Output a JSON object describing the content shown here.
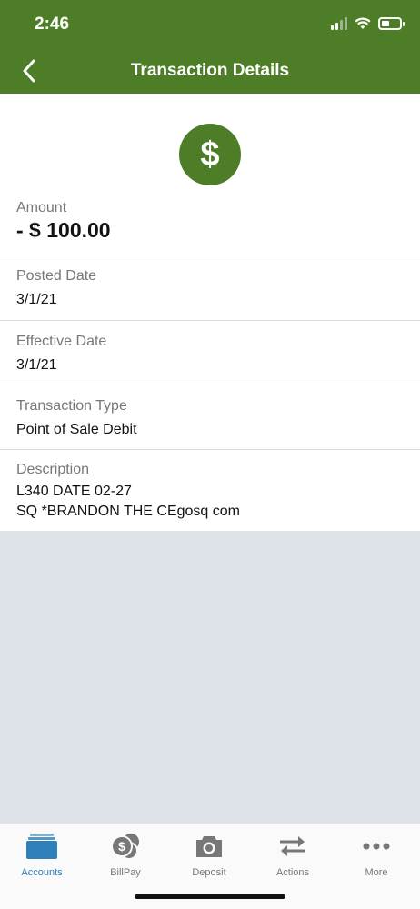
{
  "status_bar": {
    "time": "2:46"
  },
  "header": {
    "title": "Transaction Details",
    "back_icon": "chevron-left-icon"
  },
  "transaction": {
    "icon": "dollar-icon",
    "amount": {
      "label": "Amount",
      "value": "- $ 100.00"
    },
    "posted_date": {
      "label": "Posted Date",
      "value": "3/1/21"
    },
    "effective_date": {
      "label": "Effective Date",
      "value": "3/1/21"
    },
    "transaction_type": {
      "label": "Transaction Type",
      "value": "Point of Sale Debit"
    },
    "description": {
      "label": "Description",
      "line1": "L340 DATE 02-27",
      "line2": "SQ *BRANDON THE CEgosq com"
    }
  },
  "tabs": [
    {
      "label": "Accounts",
      "icon": "accounts-icon",
      "active": true
    },
    {
      "label": "BillPay",
      "icon": "billpay-icon",
      "active": false
    },
    {
      "label": "Deposit",
      "icon": "camera-icon",
      "active": false
    },
    {
      "label": "Actions",
      "icon": "transfer-arrows-icon",
      "active": false
    },
    {
      "label": "More",
      "icon": "more-dots-icon",
      "active": false
    }
  ],
  "colors": {
    "brand": "#4e7d27",
    "active_tab": "#2f7fb8",
    "inactive_tab": "#777777"
  }
}
